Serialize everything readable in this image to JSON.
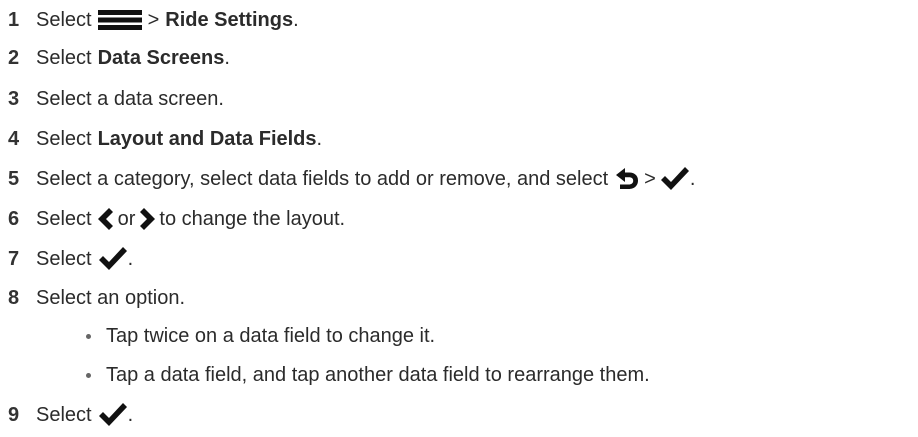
{
  "steps": [
    {
      "num": "1",
      "pre": "Select",
      "mid": ">",
      "bold": "Ride Settings",
      "post": "."
    },
    {
      "num": "2",
      "pre": "Select",
      "bold": "Data Screens",
      "post": "."
    },
    {
      "num": "3",
      "text": "Select a data screen."
    },
    {
      "num": "4",
      "pre": "Select",
      "bold": "Layout and Data Fields",
      "post": "."
    },
    {
      "num": "5",
      "pre": "Select a category, select data fields to add or remove, and select",
      "mid": ">",
      "post": "."
    },
    {
      "num": "6",
      "pre": "Select",
      "or": "or",
      "post": "to change the layout."
    },
    {
      "num": "7",
      "pre": "Select",
      "post": "."
    },
    {
      "num": "8",
      "text": "Select an option."
    },
    {
      "num": "9",
      "pre": "Select",
      "post": "."
    }
  ],
  "bullets": [
    "Tap twice on a data field to change it.",
    "Tap a data field, and tap another data field to rearrange them."
  ],
  "icons": {
    "menu": "menu-icon",
    "back": "back-arrow-icon",
    "check": "checkmark-icon",
    "left": "chevron-left-icon",
    "right": "chevron-right-icon"
  }
}
